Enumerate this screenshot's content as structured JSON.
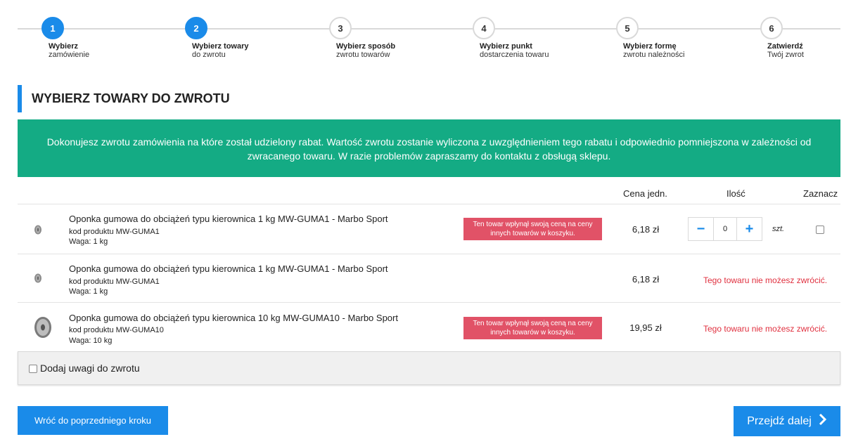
{
  "stepper": {
    "steps": [
      {
        "number": "1",
        "title": "Wybierz",
        "subtitle": "zamówienie",
        "active": true
      },
      {
        "number": "2",
        "title": "Wybierz towary",
        "subtitle": "do zwrotu",
        "active": true
      },
      {
        "number": "3",
        "title": "Wybierz sposób",
        "subtitle": "zwrotu towarów",
        "active": false
      },
      {
        "number": "4",
        "title": "Wybierz punkt",
        "subtitle": "dostarczenia towaru",
        "active": false
      },
      {
        "number": "5",
        "title": "Wybierz formę",
        "subtitle": "zwrotu należności",
        "active": false
      },
      {
        "number": "6",
        "title": "Zatwierdź",
        "subtitle": "Twój zwrot",
        "active": false
      }
    ]
  },
  "heading": "WYBIERZ TOWARY DO ZWROTU",
  "banner": "Dokonujesz zwrotu zamówienia na które został udzielony rabat. Wartość zwrotu zostanie wyliczona z uwzględnieniem tego rabatu i odpowiednio pomniejszona w zależności od zwracanego towaru. W razie problemów zapraszamy do kontaktu z obsługą sklepu.",
  "table": {
    "headers": {
      "price": "Cena jedn.",
      "qty": "Ilość",
      "select": "Zaznacz"
    },
    "rows": [
      {
        "name": "Oponka gumowa do obciążeń typu kierownica 1 kg MW-GUMA1 - Marbo Sport",
        "code": "kod produktu MW-GUMA1",
        "weight": "Waga: 1 kg",
        "warning": "Ten towar wpłynął swoją ceną na ceny innych towarów w koszyku.",
        "price": "6,18 zł",
        "qty": "0",
        "unit": "szt.",
        "returnable": true
      },
      {
        "name": "Oponka gumowa do obciążeń typu kierownica 1 kg MW-GUMA1 - Marbo Sport",
        "code": "kod produktu MW-GUMA1",
        "weight": "Waga: 1 kg",
        "price": "6,18 zł",
        "no_return": "Tego towaru nie możesz zwrócić.",
        "returnable": false
      },
      {
        "name": "Oponka gumowa do obciążeń typu kierownica 10 kg MW-GUMA10 - Marbo Sport",
        "code": "kod produktu MW-GUMA10",
        "weight": "Waga: 10 kg",
        "warning": "Ten towar wpłynął swoją ceną na ceny innych towarów w koszyku.",
        "price": "19,95 zł",
        "no_return": "Tego towaru nie możesz zwrócić.",
        "returnable": false
      }
    ]
  },
  "notes_label": "Dodaj uwagi do zwrotu",
  "buttons": {
    "back": "Wróć do poprzedniego kroku",
    "next": "Przejdź dalej"
  },
  "colors": {
    "accent": "#1a8be9",
    "banner": "#14ab84",
    "warning": "#e15267",
    "error": "#e0303f"
  }
}
